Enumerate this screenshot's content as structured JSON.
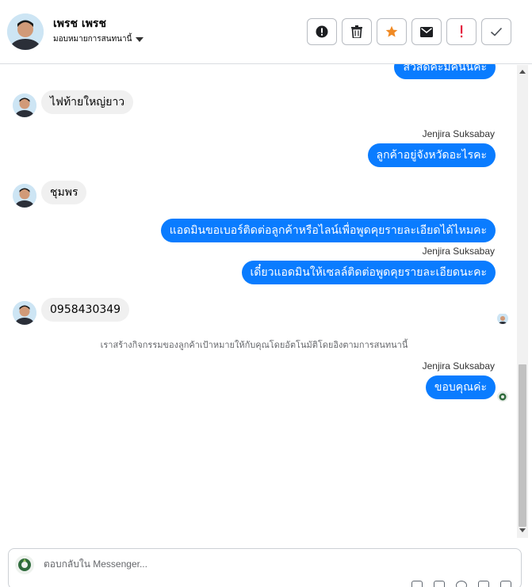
{
  "header": {
    "name": "เพรช เพรช",
    "assign_label": "มอบหมายการสนทนานี้",
    "actions": [
      {
        "name": "alert-icon",
        "glyph": "!"
      },
      {
        "name": "trash-icon",
        "glyph": ""
      },
      {
        "name": "star-icon",
        "glyph": "★"
      },
      {
        "name": "mail-icon",
        "glyph": ""
      },
      {
        "name": "spam-icon",
        "glyph": "!"
      },
      {
        "name": "check-icon",
        "glyph": "✓"
      }
    ]
  },
  "messages": {
    "m0": "สวัสดีค่ะมีคนนี้คะ",
    "m1": "ไฟท้ายใหญ่ยาว",
    "m2_sender": "Jenjira Suksabay",
    "m2": "ลูกค้าอยู่จังหวัดอะไรคะ",
    "m3": "ชุมพร",
    "m4": "แอดมินขอเบอร์ติดต่อลูกค้าหรือไลน์เพื่อพูดคุยรายละเอียดได้ไหมคะ",
    "m5_sender": "Jenjira Suksabay",
    "m5": "เดี๋ยวแอดมินให้เซลล์ติดต่อพูดคุยรายละเอียดนะคะ",
    "m6": "0958430349",
    "system": "เราสร้างกิจกรรมของลูกค้าเป้าหมายให้กับคุณโดยอัตโนมัติโดยอิงตามการสนทนานี้",
    "m7_sender": "Jenjira Suksabay",
    "m7": "ขอบคุณค่ะ"
  },
  "composer": {
    "placeholder": "ตอบกลับใน Messenger..."
  },
  "colors": {
    "outgoing": "#0a7cff",
    "incoming": "#f0f0f0",
    "star": "#f08a24",
    "spam": "#e41e3f"
  }
}
